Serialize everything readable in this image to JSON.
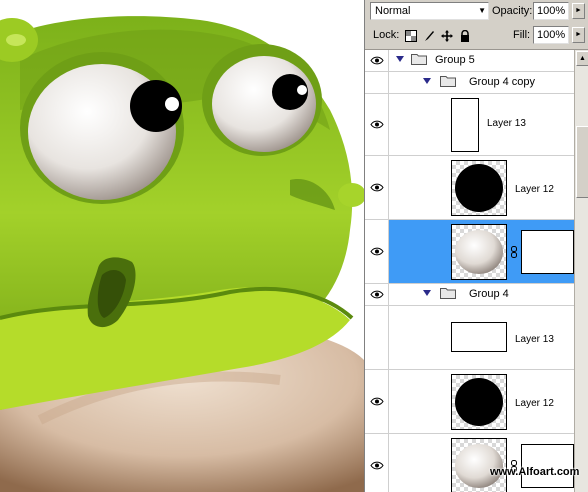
{
  "options": {
    "blend_mode": "Normal",
    "opacity_label": "Opacity:",
    "opacity_value": "100%",
    "lock_label": "Lock:",
    "fill_label": "Fill:",
    "fill_value": "100%"
  },
  "layers": [
    {
      "type": "group",
      "name": "Group 5",
      "level": 0,
      "visible": true
    },
    {
      "type": "group",
      "name": "Group 4 copy",
      "level": 1,
      "visible": false
    },
    {
      "type": "layer",
      "name": "Layer 13",
      "level": 2,
      "visible": true,
      "thumb": "white"
    },
    {
      "type": "layer",
      "name": "Layer 12",
      "level": 2,
      "visible": true,
      "thumb": "black-circle"
    },
    {
      "type": "layer",
      "name": "",
      "level": 2,
      "visible": true,
      "thumb": "eyeball",
      "selected": true,
      "mask": true
    },
    {
      "type": "group",
      "name": "Group 4",
      "level": 1,
      "visible": true
    },
    {
      "type": "layer",
      "name": "Layer 13",
      "level": 2,
      "visible": false,
      "thumb": "white"
    },
    {
      "type": "layer",
      "name": "Layer 12",
      "level": 2,
      "visible": true,
      "thumb": "black-circle"
    },
    {
      "type": "layer",
      "name": "",
      "level": 2,
      "visible": true,
      "thumb": "eyeball",
      "mask": true
    }
  ],
  "watermark": "www.Alfoart.com",
  "colors": {
    "selection": "#3f9bf6",
    "panel_bg": "#d4d0c8",
    "frog_green": "#8fc21d",
    "frog_belly": "#dcc3ac"
  }
}
